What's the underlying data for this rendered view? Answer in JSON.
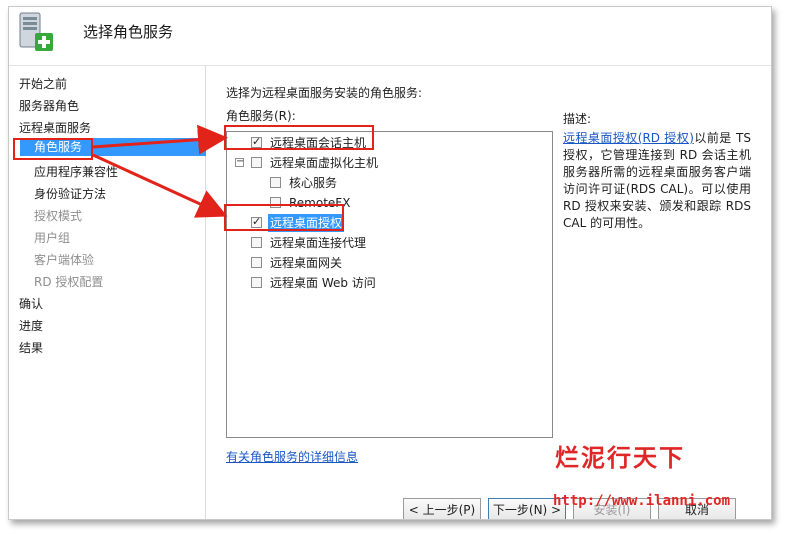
{
  "header": {
    "title": "选择角色服务",
    "icon": "server-add-icon"
  },
  "sidebar": {
    "items": [
      {
        "label": "开始之前",
        "state": "normal"
      },
      {
        "label": "服务器角色",
        "state": "normal"
      },
      {
        "label": "远程桌面服务",
        "state": "normal"
      },
      {
        "label": "角色服务",
        "state": "selected"
      },
      {
        "label": "应用程序兼容性",
        "state": "normal"
      },
      {
        "label": "身份验证方法",
        "state": "normal"
      },
      {
        "label": "授权模式",
        "state": "disabled"
      },
      {
        "label": "用户组",
        "state": "disabled"
      },
      {
        "label": "客户端体验",
        "state": "disabled"
      },
      {
        "label": "RD 授权配置",
        "state": "disabled"
      },
      {
        "label": "确认",
        "state": "normal"
      },
      {
        "label": "进度",
        "state": "normal"
      },
      {
        "label": "结果",
        "state": "normal"
      }
    ]
  },
  "main": {
    "instruction": "选择为远程桌面服务安装的角色服务:",
    "services_label": "角色服务(R):",
    "services": [
      {
        "label": "远程桌面会话主机",
        "checked": true
      },
      {
        "label": "远程桌面虚拟化主机",
        "checked": false,
        "expanded": true
      },
      {
        "label": "核心服务",
        "checked": false
      },
      {
        "label": "RemoteFX",
        "checked": false
      },
      {
        "label": "远程桌面授权",
        "checked": true,
        "selected": true
      },
      {
        "label": "远程桌面连接代理",
        "checked": false
      },
      {
        "label": "远程桌面网关",
        "checked": false
      },
      {
        "label": "远程桌面 Web 访问",
        "checked": false
      }
    ],
    "description_title": "描述:",
    "description_link": "远程桌面授权(RD 授权)",
    "description_text": "以前是 TS 授权，它管理连接到 RD 会话主机服务器所需的远程桌面服务客户端访问许可证(RDS CAL)。可以使用 RD 授权来安装、颁发和跟踪 RDS CAL 的可用性。",
    "more_info_link": "有关角色服务的详细信息"
  },
  "buttons": {
    "prev": "< 上一步(P)",
    "next": "下一步(N) >",
    "install": "安装(I)",
    "cancel": "取消"
  },
  "watermark": {
    "line1": "烂泥行天下",
    "line2": "http://www.ilanni.com"
  },
  "colors": {
    "selection": "#3399ff",
    "annotation": "#e2231a",
    "link": "#1a56c4"
  }
}
